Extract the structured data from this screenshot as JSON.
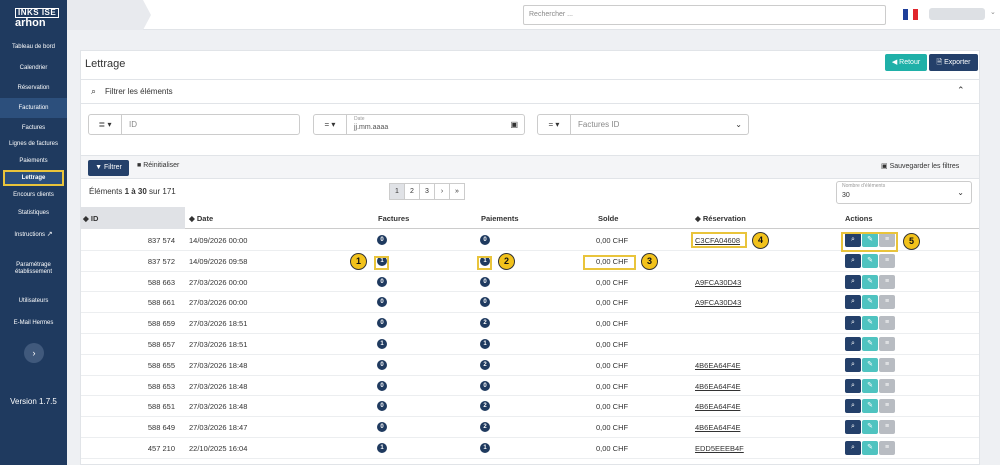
{
  "sidebar": {
    "logo_top": "INKS ISE",
    "logo_bottom": "arhon",
    "items": [
      {
        "label": "Tableau de bord"
      },
      {
        "label": "Calendrier"
      },
      {
        "label": "Réservation"
      },
      {
        "label": "Facturation"
      },
      {
        "label": "Factures"
      },
      {
        "label": "Lignes de factures"
      },
      {
        "label": "Paiements"
      },
      {
        "label": "Lettrage"
      },
      {
        "label": "Encours clients"
      },
      {
        "label": "Statistiques"
      },
      {
        "label": "Instructions"
      },
      {
        "label": "Paramétrage établissement"
      },
      {
        "label": "Utilisateurs"
      },
      {
        "label": "E-Mail Hermes"
      }
    ],
    "collapse_icon": "›",
    "version": "Version 1.7.5"
  },
  "topbar": {
    "search_placeholder": "Rechercher ...",
    "flag_colors": [
      "#1f3f9a",
      "#ffffff",
      "#e1262d"
    ]
  },
  "page": {
    "title": "Lettrage",
    "retour_label": "Retour",
    "exporter_label": "Exporter"
  },
  "filters": {
    "title": "Filtrer les éléments",
    "id_placeholder": "ID",
    "date_label": "Date",
    "date_placeholder": "jj.mm.aaaa",
    "factures_placeholder": "Factures ID",
    "filter_button": "Filtrer",
    "reset_button": "Réinitialiser",
    "save_button": "Sauvegarder les filtres"
  },
  "list": {
    "count_prefix": "Éléments ",
    "count_range": "1 à 30",
    "count_suffix": " sur 171",
    "pages": [
      "1",
      "2",
      "3",
      "›",
      "»"
    ],
    "per_page_label": "Nombre d'éléments",
    "per_page_value": "30"
  },
  "table": {
    "headers": {
      "id": "ID",
      "date": "Date",
      "factures": "Factures",
      "paiements": "Paiements",
      "solde": "Solde",
      "reservation": "Réservation",
      "actions": "Actions"
    },
    "rows": [
      {
        "id": "837 574",
        "date": "14/09/2026 00:00",
        "factures": "0",
        "paiements": "0",
        "solde": "0,00 CHF",
        "reservation": "C3CFA04608"
      },
      {
        "id": "837 572",
        "date": "14/09/2026 09:58",
        "factures": "1",
        "paiements": "1",
        "solde": "0,00 CHF",
        "reservation": ""
      },
      {
        "id": "588 663",
        "date": "27/03/2026 00:00",
        "factures": "0",
        "paiements": "0",
        "solde": "0,00 CHF",
        "reservation": "A9FCA30D43"
      },
      {
        "id": "588 661",
        "date": "27/03/2026 00:00",
        "factures": "0",
        "paiements": "0",
        "solde": "0,00 CHF",
        "reservation": "A9FCA30D43"
      },
      {
        "id": "588 659",
        "date": "27/03/2026 18:51",
        "factures": "0",
        "paiements": "2",
        "solde": "0,00 CHF",
        "reservation": ""
      },
      {
        "id": "588 657",
        "date": "27/03/2026 18:51",
        "factures": "1",
        "paiements": "1",
        "solde": "0,00 CHF",
        "reservation": ""
      },
      {
        "id": "588 655",
        "date": "27/03/2026 18:48",
        "factures": "0",
        "paiements": "2",
        "solde": "0,00 CHF",
        "reservation": "4B6EA64F4E"
      },
      {
        "id": "588 653",
        "date": "27/03/2026 18:48",
        "factures": "0",
        "paiements": "0",
        "solde": "0,00 CHF",
        "reservation": "4B6EA64F4E"
      },
      {
        "id": "588 651",
        "date": "27/03/2026 18:48",
        "factures": "0",
        "paiements": "2",
        "solde": "0,00 CHF",
        "reservation": "4B6EA64F4E"
      },
      {
        "id": "588 649",
        "date": "27/03/2026 18:47",
        "factures": "0",
        "paiements": "2",
        "solde": "0,00 CHF",
        "reservation": "4B6EA64F4E"
      },
      {
        "id": "457 210",
        "date": "22/10/2025 16:04",
        "factures": "1",
        "paiements": "1",
        "solde": "0,00 CHF",
        "reservation": "EDD5EEEB4F"
      }
    ]
  },
  "callouts": [
    "1",
    "2",
    "3",
    "4",
    "5"
  ],
  "colors": {
    "sidebar": "#1f3a5f",
    "highlight": "#e9c43b",
    "callout": "#f2c21b",
    "retour": "#1fb0a8",
    "primary": "#24406a"
  }
}
